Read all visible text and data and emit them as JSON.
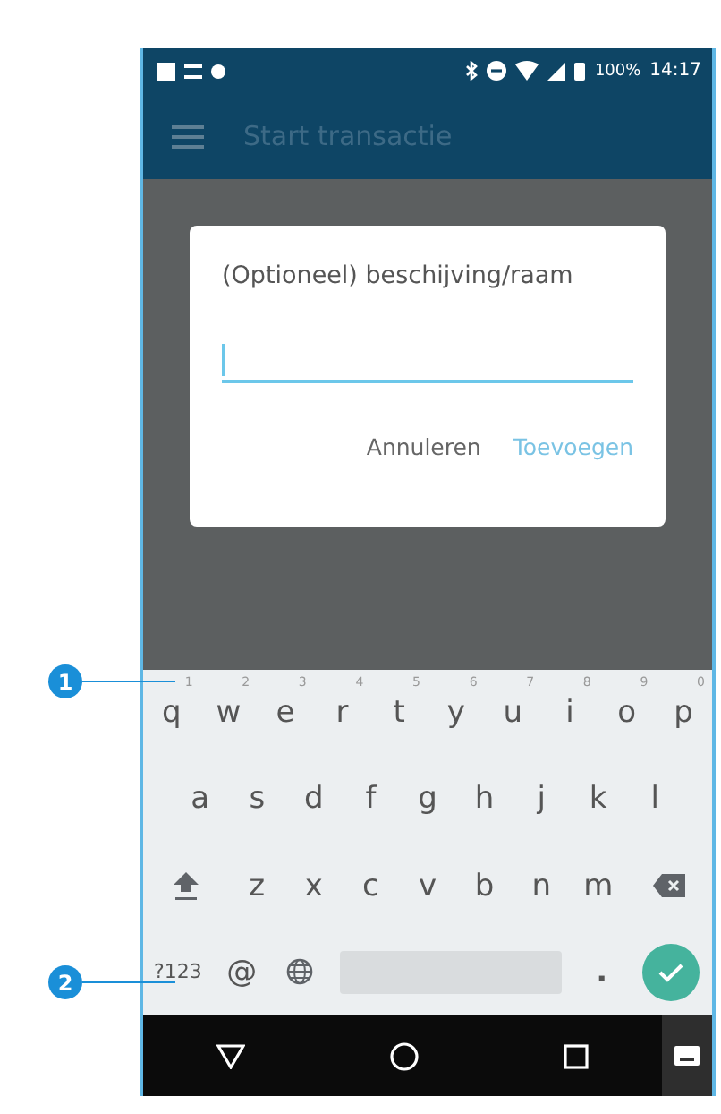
{
  "status_bar": {
    "battery": "100%",
    "time": "14:17"
  },
  "app_bar": {
    "title": "Start transactie"
  },
  "dialog": {
    "title": "(Optioneel) beschijving/raam",
    "buttons": [
      {
        "label": "Annuleren",
        "kind": "neutral"
      },
      {
        "label": "Toevoegen",
        "kind": "primary"
      }
    ]
  },
  "keyboard": {
    "rows": [
      {
        "keys": [
          {
            "kind": "letter",
            "label": "q",
            "hint": "1"
          },
          {
            "kind": "letter",
            "label": "w",
            "hint": "2"
          },
          {
            "kind": "letter",
            "label": "e",
            "hint": "3"
          },
          {
            "kind": "letter",
            "label": "r",
            "hint": "4"
          },
          {
            "kind": "letter",
            "label": "t",
            "hint": "5"
          },
          {
            "kind": "letter",
            "label": "y",
            "hint": "6"
          },
          {
            "kind": "letter",
            "label": "u",
            "hint": "7"
          },
          {
            "kind": "letter",
            "label": "i",
            "hint": "8"
          },
          {
            "kind": "letter",
            "label": "o",
            "hint": "9"
          },
          {
            "kind": "letter",
            "label": "p",
            "hint": "0"
          }
        ]
      },
      {
        "keys": [
          {
            "kind": "letter",
            "label": "a"
          },
          {
            "kind": "letter",
            "label": "s"
          },
          {
            "kind": "letter",
            "label": "d"
          },
          {
            "kind": "letter",
            "label": "f"
          },
          {
            "kind": "letter",
            "label": "g"
          },
          {
            "kind": "letter",
            "label": "h"
          },
          {
            "kind": "letter",
            "label": "j"
          },
          {
            "kind": "letter",
            "label": "k"
          },
          {
            "kind": "letter",
            "label": "l"
          }
        ]
      },
      {
        "keys": [
          {
            "kind": "shift"
          },
          {
            "kind": "letter",
            "label": "z"
          },
          {
            "kind": "letter",
            "label": "x"
          },
          {
            "kind": "letter",
            "label": "c"
          },
          {
            "kind": "letter",
            "label": "v"
          },
          {
            "kind": "letter",
            "label": "b"
          },
          {
            "kind": "letter",
            "label": "n"
          },
          {
            "kind": "letter",
            "label": "m"
          },
          {
            "kind": "backspace"
          }
        ]
      },
      {
        "keys": [
          {
            "kind": "symbols",
            "label": "?123"
          },
          {
            "kind": "letter",
            "label": "@"
          },
          {
            "kind": "globe"
          },
          {
            "kind": "space"
          },
          {
            "kind": "period",
            "label": "."
          },
          {
            "kind": "enter"
          }
        ]
      }
    ]
  },
  "callouts": [
    {
      "label": "1"
    },
    {
      "label": "2"
    }
  ]
}
